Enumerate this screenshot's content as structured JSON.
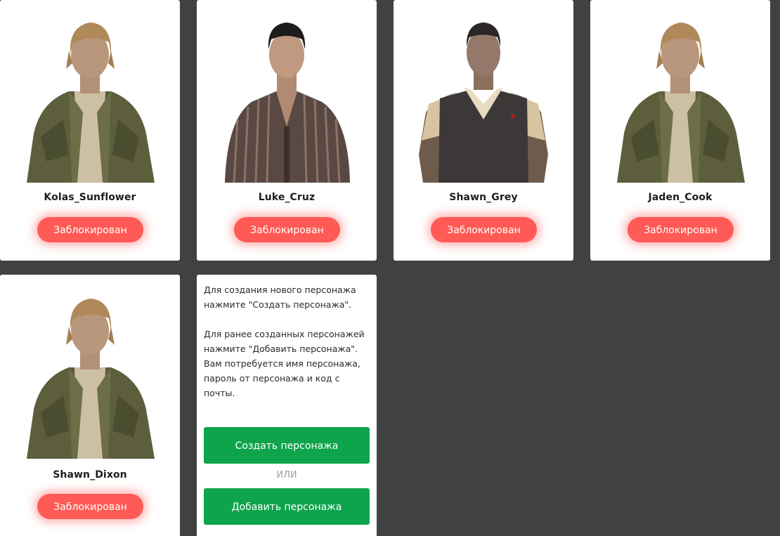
{
  "characters": [
    {
      "name": "Kolas_Sunflower",
      "status": "Заблокирован",
      "skin": "olive-jacket"
    },
    {
      "name": "Luke_Cruz",
      "status": "Заблокирован",
      "skin": "striped-shirt"
    },
    {
      "name": "Shawn_Grey",
      "status": "Заблокирован",
      "skin": "sweater-vest"
    },
    {
      "name": "Jaden_Cook",
      "status": "Заблокирован",
      "skin": "olive-jacket"
    },
    {
      "name": "Shawn_Dixon",
      "status": "Заблокирован",
      "skin": "olive-jacket"
    }
  ],
  "info": {
    "paragraph1": "Для создания нового персонажа нажмите \"Создать персонажа\".",
    "paragraph2": "Для ранее созданных персонажей нажмите \"Добавить персонажа\". Вам потребуется имя персонажа, пароль от персонажа и код с почты.",
    "create_label": "Создать персонажа",
    "or_label": "ИЛИ",
    "add_label": "Добавить персонажа"
  },
  "colors": {
    "background": "#404143",
    "blocked": "#ff5a55",
    "green": "#0ea44c"
  }
}
